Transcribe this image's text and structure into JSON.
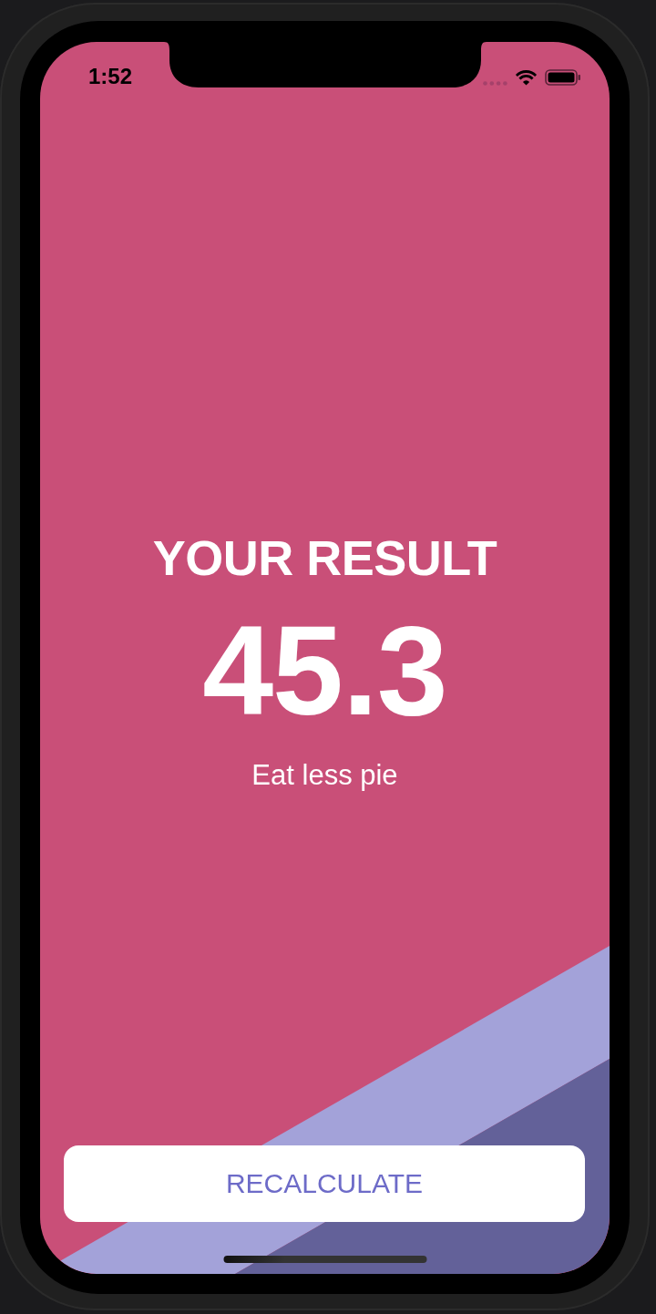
{
  "status_bar": {
    "time": "1:52"
  },
  "result": {
    "title": "YOUR RESULT",
    "value": "45.3",
    "advice": "Eat less pie"
  },
  "button": {
    "label": "RECALCULATE"
  }
}
